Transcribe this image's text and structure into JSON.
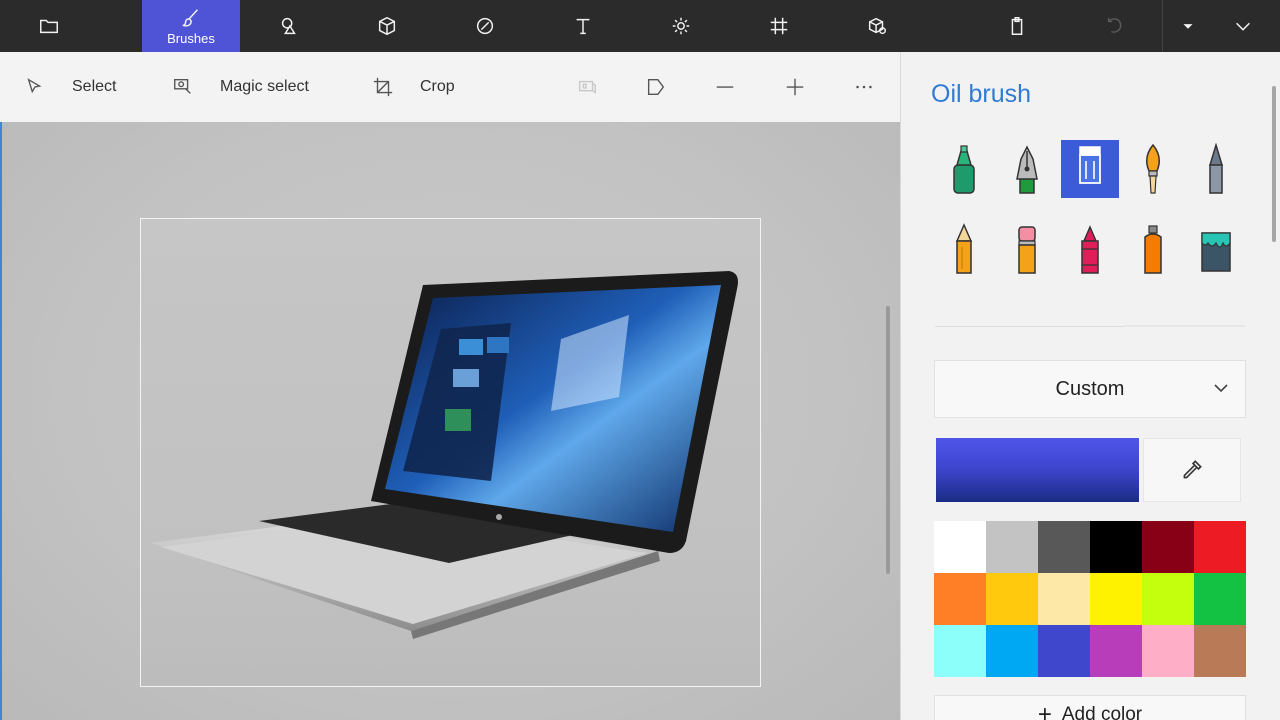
{
  "topbar": {
    "tools": [
      {
        "name": "menu-folder",
        "icon": "folder-icon",
        "label": ""
      },
      {
        "name": "brushes",
        "icon": "brush-icon",
        "label": "Brushes"
      },
      {
        "name": "2d-shapes",
        "icon": "shapes-2d-icon",
        "label": ""
      },
      {
        "name": "3d-shapes",
        "icon": "cube-icon",
        "label": ""
      },
      {
        "name": "stickers",
        "icon": "sticker-icon",
        "label": ""
      },
      {
        "name": "text",
        "icon": "text-icon",
        "label": ""
      },
      {
        "name": "effects",
        "icon": "sun-icon",
        "label": ""
      },
      {
        "name": "canvas",
        "icon": "canvas-icon",
        "label": ""
      },
      {
        "name": "3d-library",
        "icon": "library-3d-icon",
        "label": ""
      },
      {
        "name": "paste",
        "icon": "clipboard-icon",
        "label": ""
      },
      {
        "name": "undo",
        "icon": "undo-icon",
        "label": ""
      },
      {
        "name": "dropdown",
        "icon": "caret-down-icon",
        "label": ""
      },
      {
        "name": "expand",
        "icon": "chevron-down-icon",
        "label": ""
      }
    ],
    "active_color": "#4f54d6"
  },
  "subbar": {
    "select": "Select",
    "magic_select": "Magic select",
    "crop": "Crop"
  },
  "panel": {
    "title": "Oil brush",
    "brushes": [
      {
        "name": "marker",
        "selected": false
      },
      {
        "name": "calligraphy-pen",
        "selected": false
      },
      {
        "name": "oil-brush",
        "selected": true
      },
      {
        "name": "watercolor",
        "selected": false
      },
      {
        "name": "pixel-pen",
        "selected": false
      },
      {
        "name": "pencil",
        "selected": false
      },
      {
        "name": "eraser",
        "selected": false
      },
      {
        "name": "crayon",
        "selected": false
      },
      {
        "name": "spraycan",
        "selected": false
      },
      {
        "name": "fill",
        "selected": false
      }
    ],
    "dropdown_value": "Custom",
    "current_color": "#3d44cc",
    "palette": [
      "#ffffff",
      "#c3c3c3",
      "#585858",
      "#000000",
      "#880015",
      "#ed1c24",
      "#ff7f27",
      "#ffc90e",
      "#fde8a8",
      "#fff200",
      "#c4ff0e",
      "#14c243",
      "#8cfffb",
      "#00a8f3",
      "#3f48cc",
      "#b83dba",
      "#ffaec8",
      "#b97a57"
    ],
    "add_color": "Add color"
  }
}
